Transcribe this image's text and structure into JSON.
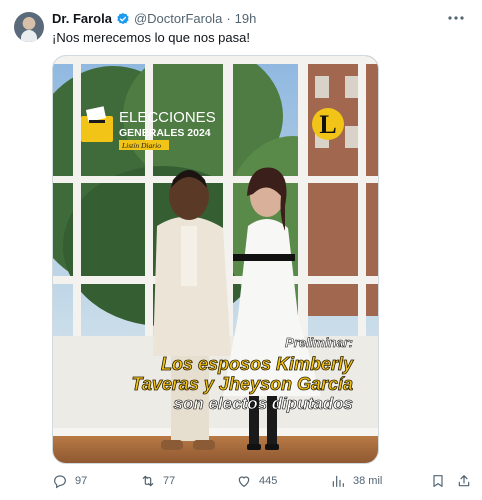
{
  "author": {
    "name": "Dr. Farola",
    "handle": "@DoctorFarola",
    "separator": "·",
    "time": "19h"
  },
  "tweet_text": "¡Nos merecemos lo que nos pasa!",
  "media": {
    "badge_line1": "ELECCIONES",
    "badge_line2": "GENERALES 2024",
    "badge_brand": "Listín Diario",
    "logo_letter": "L",
    "overlay_kicker": "Preliminar:",
    "overlay_line1": "Los esposos Kimberly",
    "overlay_line2": "Taveras y Jheyson García",
    "overlay_line3": "son electos diputados"
  },
  "actions": {
    "replies": "97",
    "reposts": "77",
    "likes": "445",
    "views": "38 mil"
  },
  "colors": {
    "verified": "#1d9bf0",
    "text_secondary": "#536471",
    "headline_yellow": "#f6c514"
  }
}
